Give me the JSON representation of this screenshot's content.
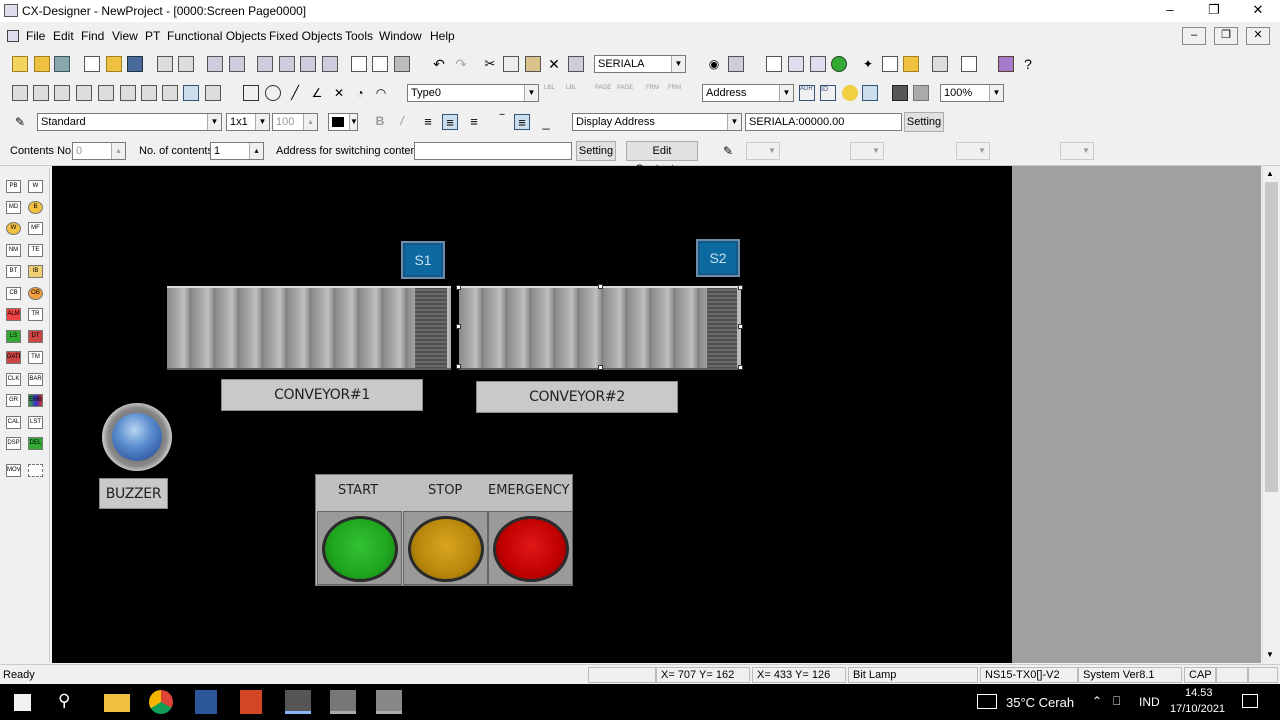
{
  "window": {
    "title": "CX-Designer - NewProject - [0000:Screen Page0000]"
  },
  "menu": [
    "File",
    "Edit",
    "Find",
    "View",
    "PT",
    "Functional Objects",
    "Fixed Objects",
    "Tools",
    "Window",
    "Help"
  ],
  "toolbar1": {
    "serial_combo": "SERIALA"
  },
  "toolbar2": {
    "type_combo": "Type0",
    "address_combo": "Address",
    "zoom_combo": "100%"
  },
  "toolbar3": {
    "font_combo": "Standard",
    "scale_combo": "1x1",
    "size_value": "100",
    "display_combo": "Display Address",
    "address_field": "SERIALA:00000.00",
    "setting_label": "Setting"
  },
  "toolbar4": {
    "contents_no_label": "Contents No.",
    "contents_no_value": "0",
    "no_of_contents_label": "No. of contents",
    "no_of_contents_value": "1",
    "switch_addr_label": "Address for switching contents",
    "setting_label": "Setting",
    "edit_contents_label": "Edit Contents..."
  },
  "left_tools": [
    "PB",
    "W",
    "MD",
    "B",
    "W",
    "MF",
    "NM",
    "TE",
    "BT",
    "IB",
    "CB",
    "OB",
    "ALM",
    "TR",
    "LS",
    "DT",
    "DATE",
    "TM",
    "CLK",
    "BAR",
    "GR",
    "EMB",
    "CAL",
    "LST",
    "DSP",
    "DEL",
    "MOV"
  ],
  "screen": {
    "sensors": [
      "S1",
      "S2"
    ],
    "conveyors": [
      "CONVEYOR#1",
      "CONVEYOR#2"
    ],
    "buzzer_label": "BUZZER",
    "buttons": [
      {
        "label": "START",
        "color": "#1ea51e"
      },
      {
        "label": "STOP",
        "color": "#b8860b"
      },
      {
        "label": "EMERGENCY",
        "color": "#c00000"
      }
    ]
  },
  "status": {
    "ready": "Ready",
    "coord1": "X= 707 Y= 162",
    "coord2": "X= 433 Y= 126",
    "object": "Bit Lamp",
    "model": "NS15-TX0[]-V2",
    "sysver": "System Ver8.1",
    "caps": "CAP"
  },
  "taskbar": {
    "weather": "35°C Cerah",
    "lang": "IND",
    "time": "14.53",
    "date": "17/10/2021"
  }
}
